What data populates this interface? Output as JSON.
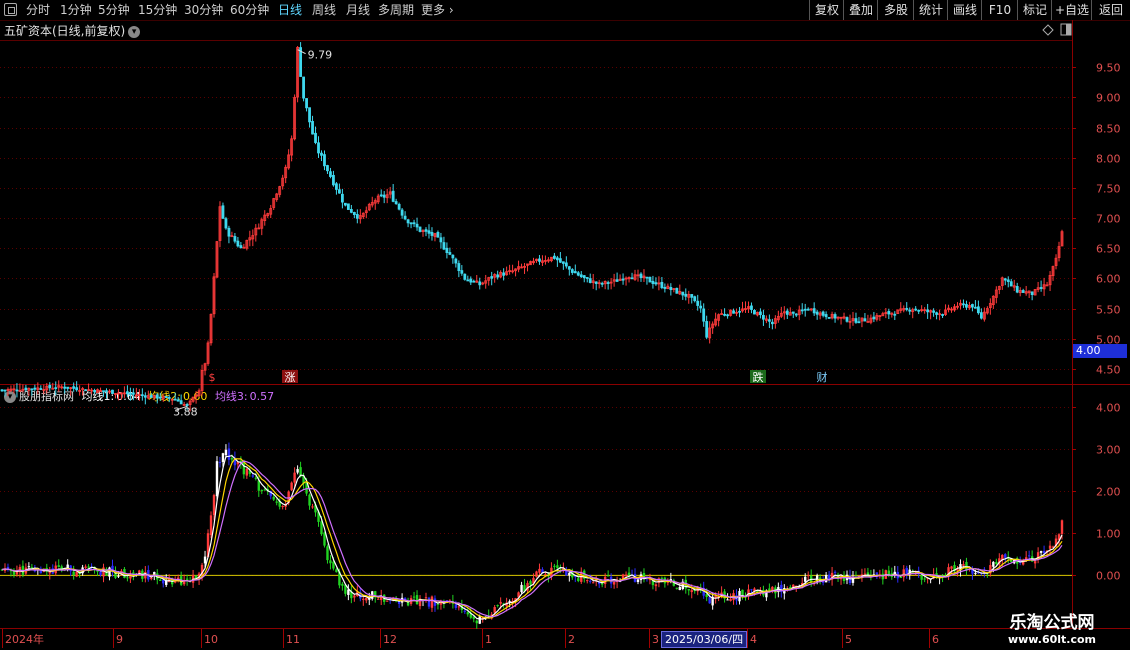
{
  "toolbar": {
    "periods": [
      {
        "label": "分时"
      },
      {
        "label": "1分钟"
      },
      {
        "label": "5分钟"
      },
      {
        "label": "15分钟"
      },
      {
        "label": "30分钟"
      },
      {
        "label": "60分钟"
      },
      {
        "label": "日线",
        "active": true
      },
      {
        "label": "周线"
      },
      {
        "label": "月线"
      },
      {
        "label": "多周期"
      },
      {
        "label": "更多 ›"
      }
    ],
    "right_buttons": [
      {
        "label": "复权"
      },
      {
        "label": "叠加"
      },
      {
        "label": "多股"
      },
      {
        "label": "统计"
      },
      {
        "label": "画线"
      },
      {
        "label": "F10"
      },
      {
        "label": "标记"
      },
      {
        "label": "+自选"
      },
      {
        "label": "返回"
      }
    ]
  },
  "main_panel": {
    "title": "五矿资本(日线,前复权)",
    "dropdown_icon": "chevron-down-icon",
    "high_label": "9.79",
    "low_label": "3.88",
    "current_price_tag": "4.00",
    "event_markers": [
      {
        "label": "$",
        "color": "#ff4040"
      },
      {
        "label": "涨",
        "color": "#ffffff",
        "bg": "#8b1010"
      },
      {
        "label": "跌",
        "color": "#ffffff",
        "bg": "#1b6a1b"
      },
      {
        "label": "财",
        "color": "#7fd0ff"
      }
    ]
  },
  "indicator_panel": {
    "name": "股朋指标网",
    "ma1_label": "均线1:",
    "ma1_value": "0.64",
    "ma2_label": "均线2:",
    "ma2_value": "0.60",
    "ma3_label": "均线3:",
    "ma3_value": "0.57"
  },
  "time_axis": {
    "labels": [
      "2024年",
      "9",
      "10",
      "11",
      "12",
      "1",
      "2",
      "3",
      "4",
      "5",
      "6"
    ],
    "cursor_date": "2025/03/06/四"
  },
  "watermark": {
    "line1": "乐淘公式网",
    "line2": "www.60lt.com"
  },
  "colors": {
    "up": "#ff3b3b",
    "down": "#3fd8ee",
    "ma1": "#ffffff",
    "ma2": "#ffd700",
    "ma3": "#d070ff",
    "grid": "#5a0000",
    "zero_line": "#d8c800"
  },
  "chart_data": [
    {
      "type": "candlestick",
      "title": "五矿资本(日线,前复权)",
      "y_ticks": [
        4.5,
        5.0,
        5.5,
        6.0,
        6.5,
        7.0,
        7.5,
        8.0,
        8.5,
        9.0,
        9.5
      ],
      "ylim": [
        4.25,
        9.95
      ],
      "anchors": [
        [
          0,
          4.15
        ],
        [
          20,
          4.2
        ],
        [
          40,
          4.1
        ],
        [
          58,
          4.0
        ],
        [
          62,
          3.88
        ],
        [
          66,
          4.15
        ],
        [
          67,
          4.45
        ],
        [
          68,
          4.6
        ],
        [
          69,
          4.9
        ],
        [
          70,
          5.4
        ],
        [
          71,
          6.0
        ],
        [
          72,
          6.6
        ],
        [
          73,
          7.2
        ],
        [
          75,
          6.8
        ],
        [
          80,
          6.5
        ],
        [
          85,
          6.8
        ],
        [
          90,
          7.2
        ],
        [
          95,
          7.8
        ],
        [
          97,
          8.3
        ],
        [
          99,
          9.79
        ],
        [
          101,
          9.0
        ],
        [
          105,
          8.2
        ],
        [
          110,
          7.7
        ],
        [
          115,
          7.2
        ],
        [
          120,
          7.0
        ],
        [
          125,
          7.3
        ],
        [
          130,
          7.4
        ],
        [
          135,
          7.0
        ],
        [
          140,
          6.8
        ],
        [
          145,
          6.7
        ],
        [
          150,
          6.4
        ],
        [
          155,
          6.0
        ],
        [
          160,
          5.9
        ],
        [
          165,
          6.05
        ],
        [
          170,
          6.1
        ],
        [
          175,
          6.2
        ],
        [
          180,
          6.3
        ],
        [
          185,
          6.35
        ],
        [
          190,
          6.15
        ],
        [
          195,
          6.0
        ],
        [
          200,
          5.9
        ],
        [
          205,
          5.95
        ],
        [
          210,
          6.05
        ],
        [
          215,
          6.0
        ],
        [
          220,
          5.9
        ],
        [
          225,
          5.8
        ],
        [
          230,
          5.7
        ],
        [
          234,
          5.5
        ],
        [
          236,
          5.05
        ],
        [
          238,
          5.25
        ],
        [
          240,
          5.4
        ],
        [
          245,
          5.45
        ],
        [
          250,
          5.5
        ],
        [
          255,
          5.35
        ],
        [
          258,
          5.25
        ],
        [
          262,
          5.45
        ],
        [
          265,
          5.4
        ],
        [
          270,
          5.5
        ],
        [
          275,
          5.4
        ],
        [
          280,
          5.35
        ],
        [
          285,
          5.3
        ],
        [
          290,
          5.32
        ],
        [
          295,
          5.4
        ],
        [
          300,
          5.45
        ],
        [
          305,
          5.5
        ],
        [
          310,
          5.45
        ],
        [
          315,
          5.42
        ],
        [
          320,
          5.55
        ],
        [
          325,
          5.55
        ],
        [
          328,
          5.35
        ],
        [
          332,
          5.7
        ],
        [
          335,
          6.0
        ],
        [
          340,
          5.8
        ],
        [
          345,
          5.75
        ],
        [
          350,
          5.9
        ],
        [
          353,
          6.3
        ],
        [
          355,
          6.75
        ]
      ],
      "high": 9.79,
      "low": 3.88,
      "last": 6.75
    },
    {
      "type": "line",
      "title": "股朋指标网",
      "y_ticks": [
        0.0,
        1.0,
        2.0,
        3.0,
        4.0
      ],
      "ylim": [
        -1.25,
        4.5
      ],
      "series": [
        {
          "name": "均线1",
          "value": 0.64,
          "color": "#ffffff"
        },
        {
          "name": "均线2",
          "value": 0.6,
          "color": "#ffd700"
        },
        {
          "name": "均线3",
          "value": 0.57,
          "color": "#d070ff"
        }
      ],
      "anchors": [
        [
          0,
          0.1
        ],
        [
          20,
          0.15
        ],
        [
          40,
          0.05
        ],
        [
          58,
          -0.1
        ],
        [
          62,
          -0.15
        ],
        [
          66,
          -0.05
        ],
        [
          68,
          0.5
        ],
        [
          70,
          1.4
        ],
        [
          72,
          2.6
        ],
        [
          74,
          3.0
        ],
        [
          80,
          2.6
        ],
        [
          85,
          2.2
        ],
        [
          90,
          1.8
        ],
        [
          95,
          1.6
        ],
        [
          97,
          2.2
        ],
        [
          99,
          2.5
        ],
        [
          101,
          2.1
        ],
        [
          105,
          1.4
        ],
        [
          110,
          0.2
        ],
        [
          115,
          -0.4
        ],
        [
          120,
          -0.5
        ],
        [
          125,
          -0.5
        ],
        [
          130,
          -0.55
        ],
        [
          135,
          -0.6
        ],
        [
          140,
          -0.65
        ],
        [
          145,
          -0.6
        ],
        [
          150,
          -0.7
        ],
        [
          155,
          -0.9
        ],
        [
          160,
          -1.05
        ],
        [
          165,
          -0.85
        ],
        [
          170,
          -0.55
        ],
        [
          175,
          -0.3
        ],
        [
          180,
          0.05
        ],
        [
          185,
          0.1
        ],
        [
          190,
          0.05
        ],
        [
          195,
          -0.05
        ],
        [
          200,
          -0.15
        ],
        [
          205,
          -0.1
        ],
        [
          210,
          -0.05
        ],
        [
          215,
          -0.1
        ],
        [
          220,
          -0.15
        ],
        [
          225,
          -0.2
        ],
        [
          230,
          -0.3
        ],
        [
          234,
          -0.4
        ],
        [
          236,
          -0.6
        ],
        [
          240,
          -0.5
        ],
        [
          245,
          -0.5
        ],
        [
          250,
          -0.45
        ],
        [
          255,
          -0.35
        ],
        [
          260,
          -0.3
        ],
        [
          265,
          -0.2
        ],
        [
          270,
          -0.1
        ],
        [
          275,
          -0.05
        ],
        [
          280,
          0.0
        ],
        [
          285,
          -0.1
        ],
        [
          290,
          -0.05
        ],
        [
          295,
          0.0
        ],
        [
          300,
          0.05
        ],
        [
          305,
          0.05
        ],
        [
          310,
          0.0
        ],
        [
          315,
          0.1
        ],
        [
          320,
          0.15
        ],
        [
          325,
          0.15
        ],
        [
          328,
          0.0
        ],
        [
          332,
          0.2
        ],
        [
          335,
          0.4
        ],
        [
          340,
          0.4
        ],
        [
          345,
          0.45
        ],
        [
          350,
          0.5
        ],
        [
          353,
          0.8
        ],
        [
          355,
          1.3
        ]
      ]
    }
  ]
}
